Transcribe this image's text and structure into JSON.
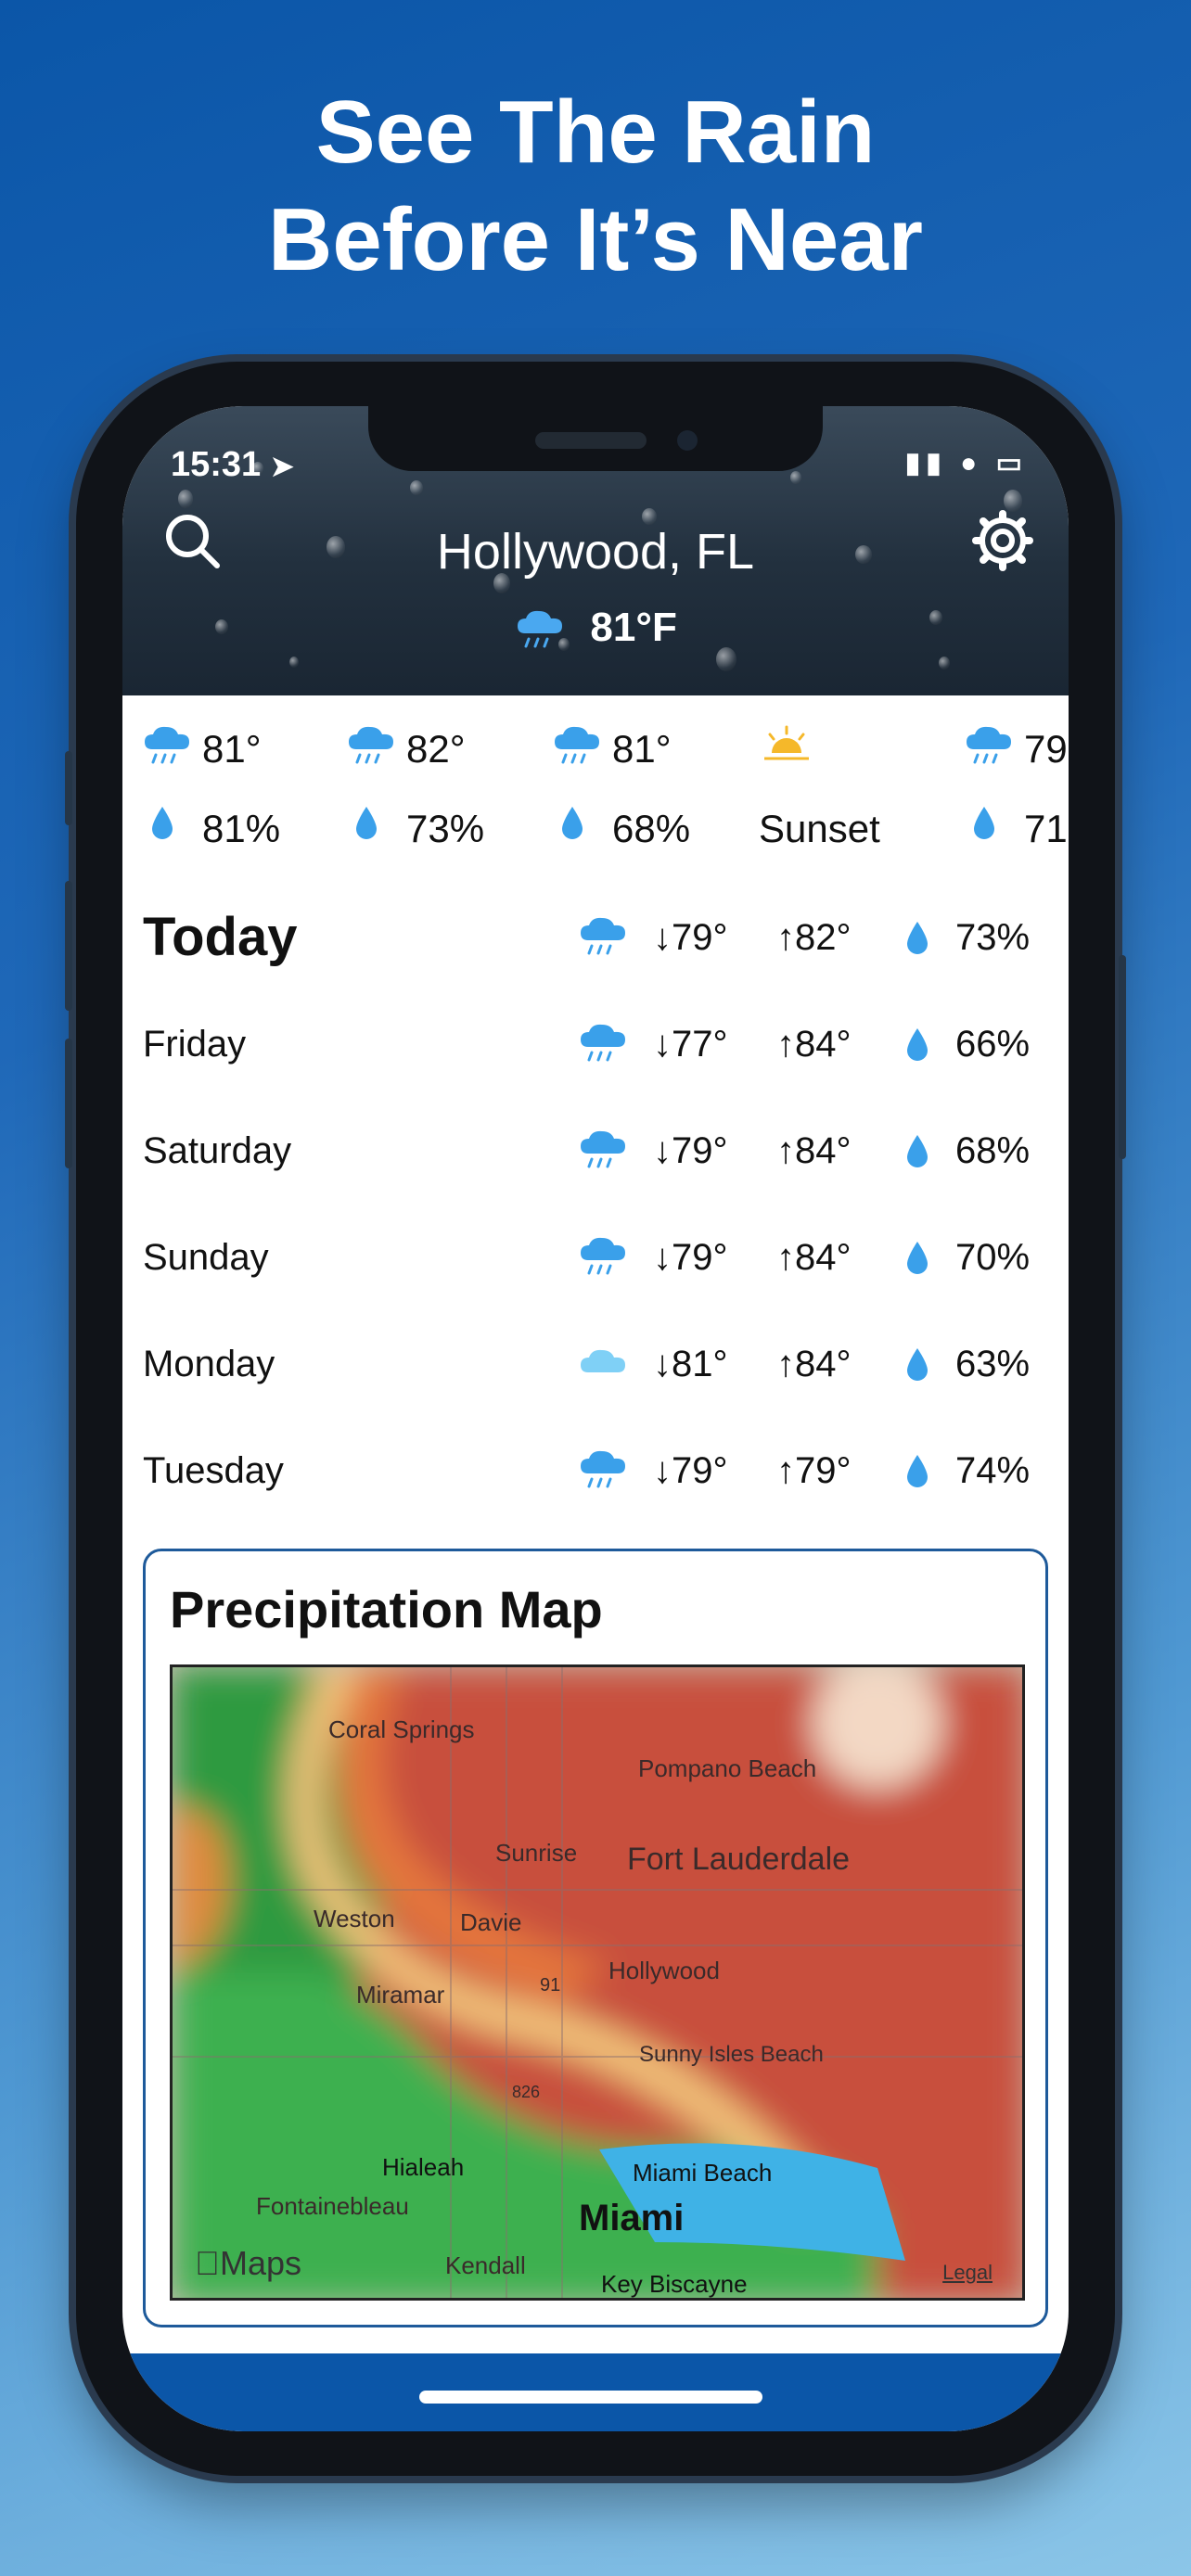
{
  "headline": {
    "line1": "See The Rain",
    "line2": "Before It’s Near"
  },
  "status": {
    "time": "15:31"
  },
  "header": {
    "city": "Hollywood, FL",
    "current_temp": "81°F"
  },
  "hourly": [
    {
      "temp": "81°",
      "precip": "81%",
      "icon": "rain-cloud-icon"
    },
    {
      "temp": "82°",
      "precip": "73%",
      "icon": "rain-cloud-icon"
    },
    {
      "temp": "81°",
      "precip": "68%",
      "icon": "rain-cloud-icon"
    },
    {
      "temp": "",
      "precip": "Sunset",
      "icon": "sunset-icon"
    },
    {
      "temp": "79",
      "precip": "71",
      "icon": "rain-cloud-icon"
    }
  ],
  "daily": [
    {
      "day": "Today",
      "low": "↓79°",
      "high": "↑82°",
      "precip": "73%",
      "icon": "rain-cloud-icon"
    },
    {
      "day": "Friday",
      "low": "↓77°",
      "high": "↑84°",
      "precip": "66%",
      "icon": "rain-cloud-icon"
    },
    {
      "day": "Saturday",
      "low": "↓79°",
      "high": "↑84°",
      "precip": "68%",
      "icon": "rain-cloud-icon"
    },
    {
      "day": "Sunday",
      "low": "↓79°",
      "high": "↑84°",
      "precip": "70%",
      "icon": "rain-cloud-icon"
    },
    {
      "day": "Monday",
      "low": "↓81°",
      "high": "↑84°",
      "precip": "63%",
      "icon": "cloud-icon"
    },
    {
      "day": "Tuesday",
      "low": "↓79°",
      "high": "↑79°",
      "precip": "74%",
      "icon": "rain-cloud-icon"
    }
  ],
  "map": {
    "title": "Precipitation Map",
    "labels": {
      "coral_springs": "Coral Springs",
      "pompano_beach": "Pompano Beach",
      "sunrise": "Sunrise",
      "fort_lauderdale": "Fort Lauderdale",
      "weston": "Weston",
      "davie": "Davie",
      "hollywood": "Hollywood",
      "miramar": "Miramar",
      "sunny_isles": "Sunny Isles Beach",
      "hialeah": "Hialeah",
      "miami_beach": "Miami Beach",
      "fontainebleau": "Fontainebleau",
      "miami": "Miami",
      "kendall": "Kendall",
      "key_biscayne": "Key Biscayne",
      "shield_91": "91",
      "shield_826": "826"
    },
    "logo": "Maps",
    "legal": "Legal"
  },
  "colors": {
    "brand_blue": "#0b56a8",
    "rain_icon_blue": "#3aa0ea",
    "precip_red": "#c84a3a",
    "precip_green": "#2f9a3f"
  }
}
